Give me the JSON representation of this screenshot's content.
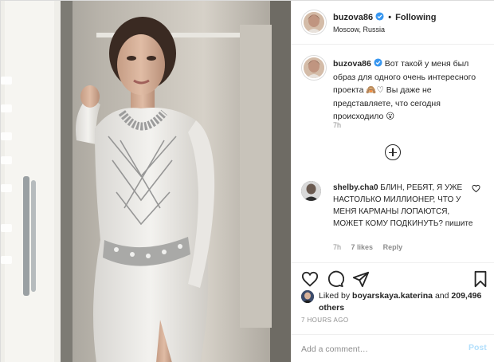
{
  "header": {
    "username": "buzova86",
    "separator": "•",
    "follow_status": "Following",
    "location": "Moscow, Russia"
  },
  "caption": {
    "username": "buzova86",
    "text": "Вот такой у меня был образ для одного очень интересного проекта 🙈♡ Вы даже не представляете, что сегодня происходило 😮",
    "time": "7h"
  },
  "comment": {
    "username": "shelby.cha0",
    "text": "БЛИН, РЕБЯТ, Я УЖЕ НАСТОЛЬКО МИЛЛИОНЕР, ЧТО У МЕНЯ КАРМАНЫ ЛОПАЮТСЯ, МОЖЕТ КОМУ ПОДКИНУТЬ? пишите",
    "time": "7h",
    "likes": "7 likes",
    "reply": "Reply"
  },
  "likes": {
    "prefix": "Liked by",
    "user": "boyarskaya.katerina",
    "and": "and",
    "count": "209,496 others"
  },
  "timestamp": "7 HOURS AGO",
  "add_comment": {
    "placeholder": "Add a comment…",
    "post_label": "Post"
  },
  "colors": {
    "verified": "#3897f0",
    "post_disabled": "#b2dffc",
    "muted_text": "#8e8e8e",
    "border": "#efefef"
  },
  "icons": {
    "like": "heart-icon",
    "comment": "comment-icon",
    "share": "paper-plane-icon",
    "save": "bookmark-icon",
    "load_more": "plus-circle-icon"
  }
}
